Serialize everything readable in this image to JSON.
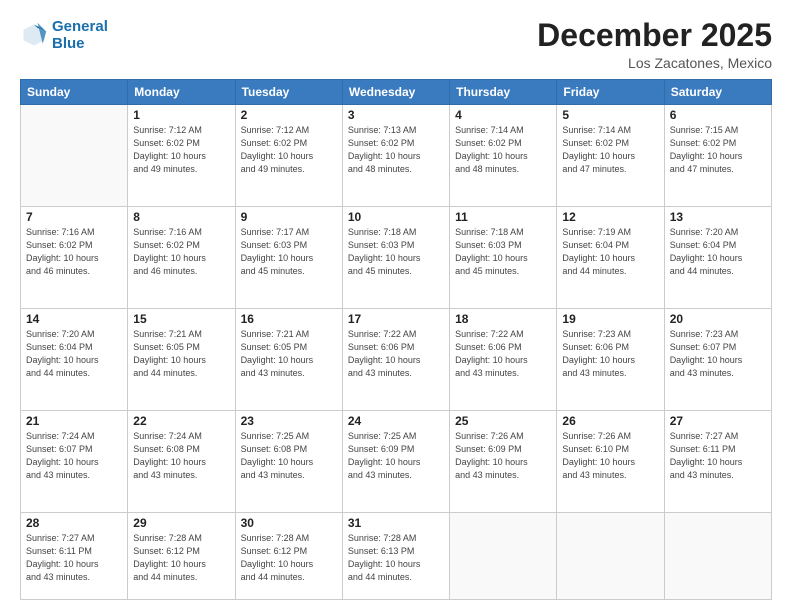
{
  "logo": {
    "line1": "General",
    "line2": "Blue"
  },
  "title": "December 2025",
  "location": "Los Zacatones, Mexico",
  "days_header": [
    "Sunday",
    "Monday",
    "Tuesday",
    "Wednesday",
    "Thursday",
    "Friday",
    "Saturday"
  ],
  "weeks": [
    [
      {
        "num": "",
        "empty": true
      },
      {
        "num": "1",
        "sunrise": "7:12 AM",
        "sunset": "6:02 PM",
        "daylight": "10 hours and 49 minutes."
      },
      {
        "num": "2",
        "sunrise": "7:12 AM",
        "sunset": "6:02 PM",
        "daylight": "10 hours and 49 minutes."
      },
      {
        "num": "3",
        "sunrise": "7:13 AM",
        "sunset": "6:02 PM",
        "daylight": "10 hours and 48 minutes."
      },
      {
        "num": "4",
        "sunrise": "7:14 AM",
        "sunset": "6:02 PM",
        "daylight": "10 hours and 48 minutes."
      },
      {
        "num": "5",
        "sunrise": "7:14 AM",
        "sunset": "6:02 PM",
        "daylight": "10 hours and 47 minutes."
      },
      {
        "num": "6",
        "sunrise": "7:15 AM",
        "sunset": "6:02 PM",
        "daylight": "10 hours and 47 minutes."
      }
    ],
    [
      {
        "num": "7",
        "sunrise": "7:16 AM",
        "sunset": "6:02 PM",
        "daylight": "10 hours and 46 minutes."
      },
      {
        "num": "8",
        "sunrise": "7:16 AM",
        "sunset": "6:02 PM",
        "daylight": "10 hours and 46 minutes."
      },
      {
        "num": "9",
        "sunrise": "7:17 AM",
        "sunset": "6:03 PM",
        "daylight": "10 hours and 45 minutes."
      },
      {
        "num": "10",
        "sunrise": "7:18 AM",
        "sunset": "6:03 PM",
        "daylight": "10 hours and 45 minutes."
      },
      {
        "num": "11",
        "sunrise": "7:18 AM",
        "sunset": "6:03 PM",
        "daylight": "10 hours and 45 minutes."
      },
      {
        "num": "12",
        "sunrise": "7:19 AM",
        "sunset": "6:04 PM",
        "daylight": "10 hours and 44 minutes."
      },
      {
        "num": "13",
        "sunrise": "7:20 AM",
        "sunset": "6:04 PM",
        "daylight": "10 hours and 44 minutes."
      }
    ],
    [
      {
        "num": "14",
        "sunrise": "7:20 AM",
        "sunset": "6:04 PM",
        "daylight": "10 hours and 44 minutes."
      },
      {
        "num": "15",
        "sunrise": "7:21 AM",
        "sunset": "6:05 PM",
        "daylight": "10 hours and 44 minutes."
      },
      {
        "num": "16",
        "sunrise": "7:21 AM",
        "sunset": "6:05 PM",
        "daylight": "10 hours and 43 minutes."
      },
      {
        "num": "17",
        "sunrise": "7:22 AM",
        "sunset": "6:06 PM",
        "daylight": "10 hours and 43 minutes."
      },
      {
        "num": "18",
        "sunrise": "7:22 AM",
        "sunset": "6:06 PM",
        "daylight": "10 hours and 43 minutes."
      },
      {
        "num": "19",
        "sunrise": "7:23 AM",
        "sunset": "6:06 PM",
        "daylight": "10 hours and 43 minutes."
      },
      {
        "num": "20",
        "sunrise": "7:23 AM",
        "sunset": "6:07 PM",
        "daylight": "10 hours and 43 minutes."
      }
    ],
    [
      {
        "num": "21",
        "sunrise": "7:24 AM",
        "sunset": "6:07 PM",
        "daylight": "10 hours and 43 minutes."
      },
      {
        "num": "22",
        "sunrise": "7:24 AM",
        "sunset": "6:08 PM",
        "daylight": "10 hours and 43 minutes."
      },
      {
        "num": "23",
        "sunrise": "7:25 AM",
        "sunset": "6:08 PM",
        "daylight": "10 hours and 43 minutes."
      },
      {
        "num": "24",
        "sunrise": "7:25 AM",
        "sunset": "6:09 PM",
        "daylight": "10 hours and 43 minutes."
      },
      {
        "num": "25",
        "sunrise": "7:26 AM",
        "sunset": "6:09 PM",
        "daylight": "10 hours and 43 minutes."
      },
      {
        "num": "26",
        "sunrise": "7:26 AM",
        "sunset": "6:10 PM",
        "daylight": "10 hours and 43 minutes."
      },
      {
        "num": "27",
        "sunrise": "7:27 AM",
        "sunset": "6:11 PM",
        "daylight": "10 hours and 43 minutes."
      }
    ],
    [
      {
        "num": "28",
        "sunrise": "7:27 AM",
        "sunset": "6:11 PM",
        "daylight": "10 hours and 43 minutes."
      },
      {
        "num": "29",
        "sunrise": "7:28 AM",
        "sunset": "6:12 PM",
        "daylight": "10 hours and 44 minutes."
      },
      {
        "num": "30",
        "sunrise": "7:28 AM",
        "sunset": "6:12 PM",
        "daylight": "10 hours and 44 minutes."
      },
      {
        "num": "31",
        "sunrise": "7:28 AM",
        "sunset": "6:13 PM",
        "daylight": "10 hours and 44 minutes."
      },
      {
        "num": "",
        "empty": true
      },
      {
        "num": "",
        "empty": true
      },
      {
        "num": "",
        "empty": true
      }
    ]
  ],
  "labels": {
    "sunrise_prefix": "Sunrise: ",
    "sunset_prefix": "Sunset: ",
    "daylight_prefix": "Daylight: "
  }
}
